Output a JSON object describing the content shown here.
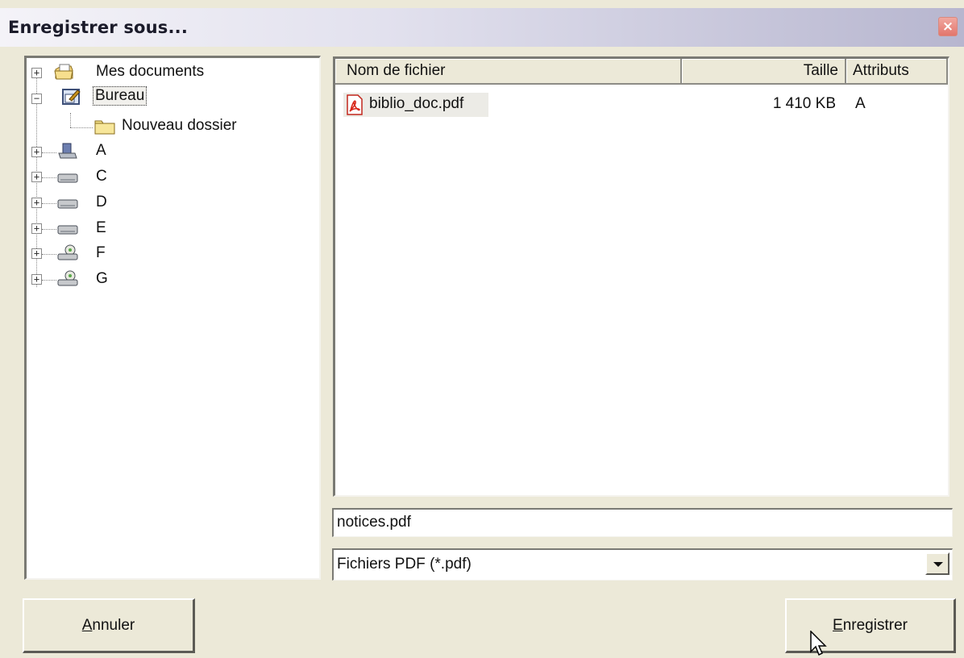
{
  "window": {
    "title": "Enregistrer sous...",
    "close_label": "×"
  },
  "tree": {
    "items": [
      {
        "label": "Mes documents",
        "icon": "my-documents-icon",
        "expander": "+"
      },
      {
        "label": "Bureau",
        "icon": "desktop-icon",
        "expander": "−",
        "selected": true
      },
      {
        "label": "Nouveau dossier",
        "icon": "folder-icon"
      },
      {
        "label": "A",
        "icon": "floppy-drive-icon",
        "expander": "+"
      },
      {
        "label": "C",
        "icon": "hard-drive-icon",
        "expander": "+"
      },
      {
        "label": "D",
        "icon": "hard-drive-icon",
        "expander": "+"
      },
      {
        "label": "E",
        "icon": "hard-drive-icon",
        "expander": "+"
      },
      {
        "label": "F",
        "icon": "cd-drive-icon",
        "expander": "+"
      },
      {
        "label": "G",
        "icon": "cd-drive-icon",
        "expander": "+"
      }
    ]
  },
  "file_list": {
    "columns": [
      "Nom de fichier",
      "Taille",
      "Attributs"
    ],
    "rows": [
      {
        "name": "biblio_doc.pdf",
        "size": "1 410 KB",
        "attributes": "A",
        "icon": "pdf-file-icon"
      }
    ]
  },
  "filename_input": {
    "value": "notices.pdf"
  },
  "filetype_select": {
    "value": "Fichiers PDF (*.pdf)"
  },
  "buttons": {
    "cancel": {
      "mnemonic": "A",
      "rest": "nnuler"
    },
    "save": {
      "mnemonic": "E",
      "rest": "nregistrer"
    }
  },
  "colors": {
    "dialog_bg": "#ece9d8",
    "title_gradient_end": "#b7b6cf",
    "close_button": "#e3766c"
  }
}
